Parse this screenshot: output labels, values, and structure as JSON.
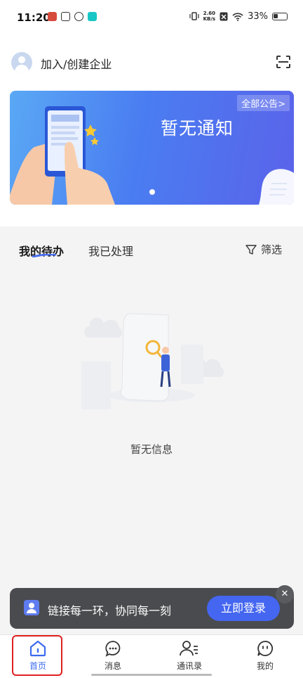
{
  "status_bar": {
    "time": "11:20",
    "net_speed_value": "2.60",
    "net_speed_unit": "KB/s",
    "battery": "33%"
  },
  "header": {
    "join_label": "加入/创建企业",
    "scan_icon": "scan-icon"
  },
  "banner": {
    "title": "暂无通知",
    "all_link": "全部公告>"
  },
  "tasks": {
    "tabs": [
      "我的待办",
      "我已处理"
    ],
    "filter_label": "筛选",
    "empty_text": "暂无信息"
  },
  "toast": {
    "message": "链接每一环，协同每一刻",
    "login_button": "立即登录",
    "close_glyph": "✕"
  },
  "bottom_nav": [
    {
      "label": "首页",
      "icon": "home-icon",
      "active": true
    },
    {
      "label": "消息",
      "icon": "chat-bubble-icon",
      "active": false
    },
    {
      "label": "通讯录",
      "icon": "contacts-icon",
      "active": false
    },
    {
      "label": "我的",
      "icon": "profile-icon",
      "active": false
    }
  ],
  "colors": {
    "accent": "#4466f0",
    "highlight_box": "#e02020",
    "toast_bg": "#4a4b4e"
  }
}
